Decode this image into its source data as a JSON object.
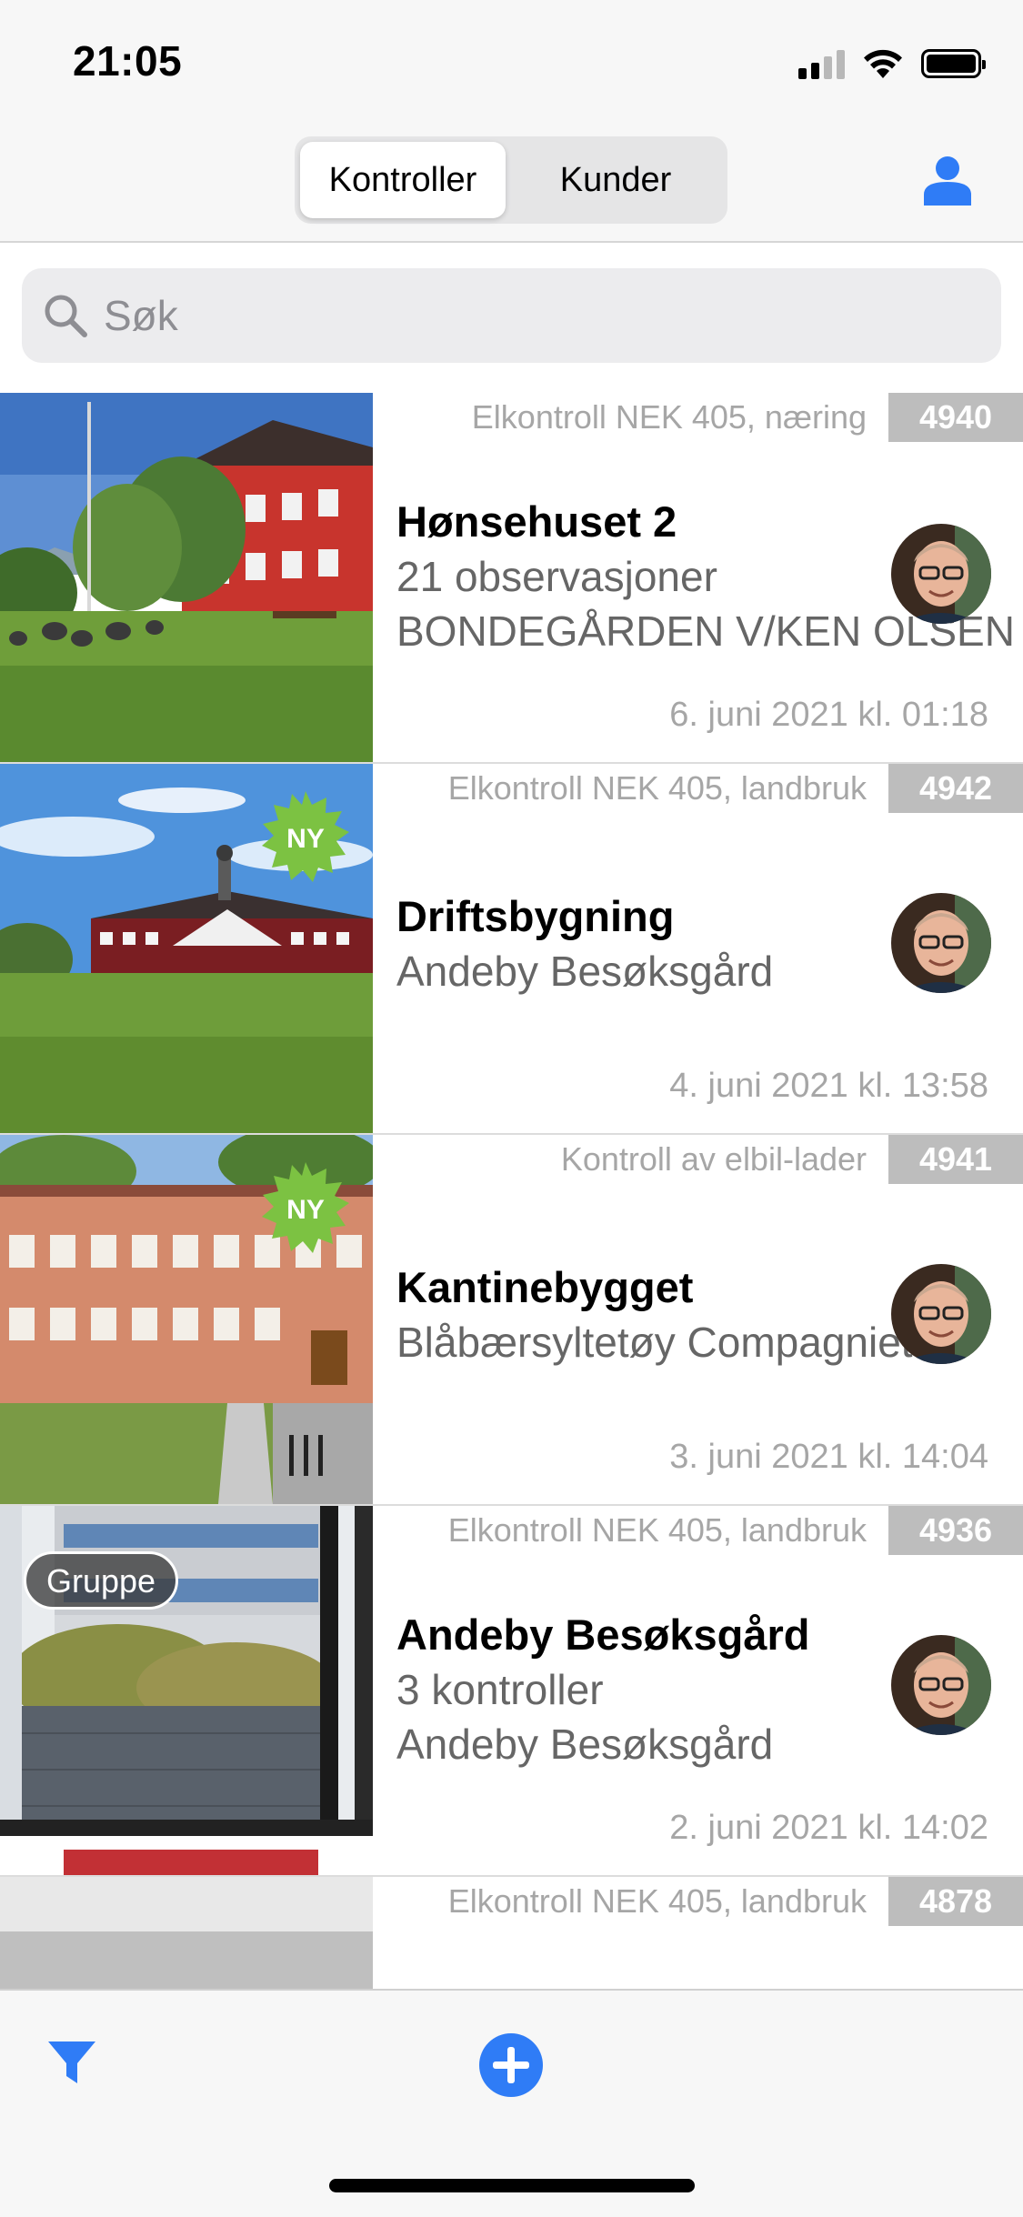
{
  "status_bar": {
    "time": "21:05"
  },
  "nav": {
    "segments": [
      "Kontroller",
      "Kunder"
    ],
    "selected_segment": "Kontroller",
    "profile_icon": "person-icon",
    "accent_color": "#2f7cf6"
  },
  "search": {
    "placeholder": "Søk",
    "value": ""
  },
  "items": [
    {
      "type": "Elkontroll NEK 405, næring",
      "number": "4940",
      "title": "Hønsehuset 2",
      "lines": [
        "21 observasjoner",
        "BONDEGÅRDEN V/KEN OLSEN"
      ],
      "date": "6. juni 2021 kl. 01:18",
      "badge": ""
    },
    {
      "type": "Elkontroll NEK 405, landbruk",
      "number": "4942",
      "title": "Driftsbygning",
      "lines": [
        "Andeby Besøksgård"
      ],
      "date": "4. juni 2021 kl. 13:58",
      "badge": "NY"
    },
    {
      "type": "Kontroll av elbil-lader",
      "number": "4941",
      "title": "Kantinebygget",
      "lines": [
        "Blåbærsyltetøy Compagniet"
      ],
      "date": "3. juni 2021 kl. 14:04",
      "badge": "NY"
    },
    {
      "type": "Elkontroll NEK 405, landbruk",
      "number": "4936",
      "title": "Andeby Besøksgård",
      "lines": [
        "3 kontroller",
        "Andeby Besøksgård"
      ],
      "date": "2. juni 2021 kl. 14:02",
      "badge": "Gruppe"
    },
    {
      "type": "Elkontroll NEK 405, landbruk",
      "number": "4878",
      "title": "",
      "lines": [],
      "date": "",
      "badge": ""
    }
  ],
  "bottom_bar": {
    "filter_icon": "filter-icon",
    "add_icon": "plus-circle-icon"
  },
  "colors": {
    "number_badge": "#bdbdbd",
    "ny_badge": "#7cc242"
  }
}
